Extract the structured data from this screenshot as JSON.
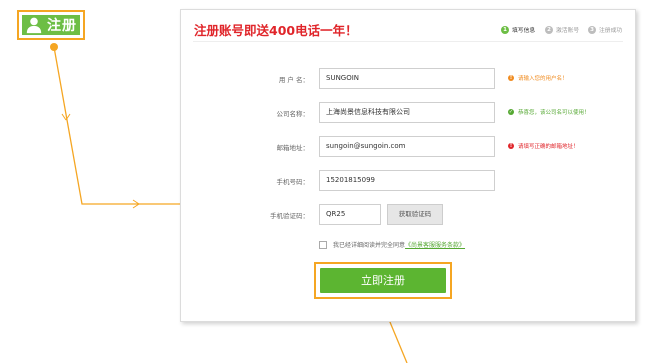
{
  "badge": {
    "label": "注册",
    "icon": "user-icon"
  },
  "card": {
    "title": "注册账号即送400电话一年！",
    "steps": [
      {
        "num": "1",
        "label": "填写信息",
        "active": true
      },
      {
        "num": "2",
        "label": "激活账号",
        "active": false
      },
      {
        "num": "3",
        "label": "注册成功",
        "active": false
      }
    ],
    "form": {
      "username": {
        "label": "用 户 名：",
        "value": "SUNGOIN",
        "hint": "请输入您的用户名！",
        "hint_type": "warn"
      },
      "company": {
        "label": "公司名称：",
        "value": "上海尚景信息科技有限公司",
        "hint": "恭喜您，该公司名可以使用！",
        "hint_type": "ok"
      },
      "email": {
        "label": "邮箱地址：",
        "value": "sungoin@sungoin.com",
        "hint": "请填写正确的邮箱地址！",
        "hint_type": "err"
      },
      "phone": {
        "label": "手机号码：",
        "value": "15201815099"
      },
      "code": {
        "label": "手机验证码：",
        "value": "QR25",
        "button": "获取验证码"
      },
      "agree_text": "我已经详细阅读并完全同意",
      "agree_link": "《尚景客服服务条款》",
      "submit": "立即注册"
    }
  },
  "colors": {
    "accent": "#f5a623",
    "green": "#5cb531",
    "title_red": "#e0252a"
  }
}
